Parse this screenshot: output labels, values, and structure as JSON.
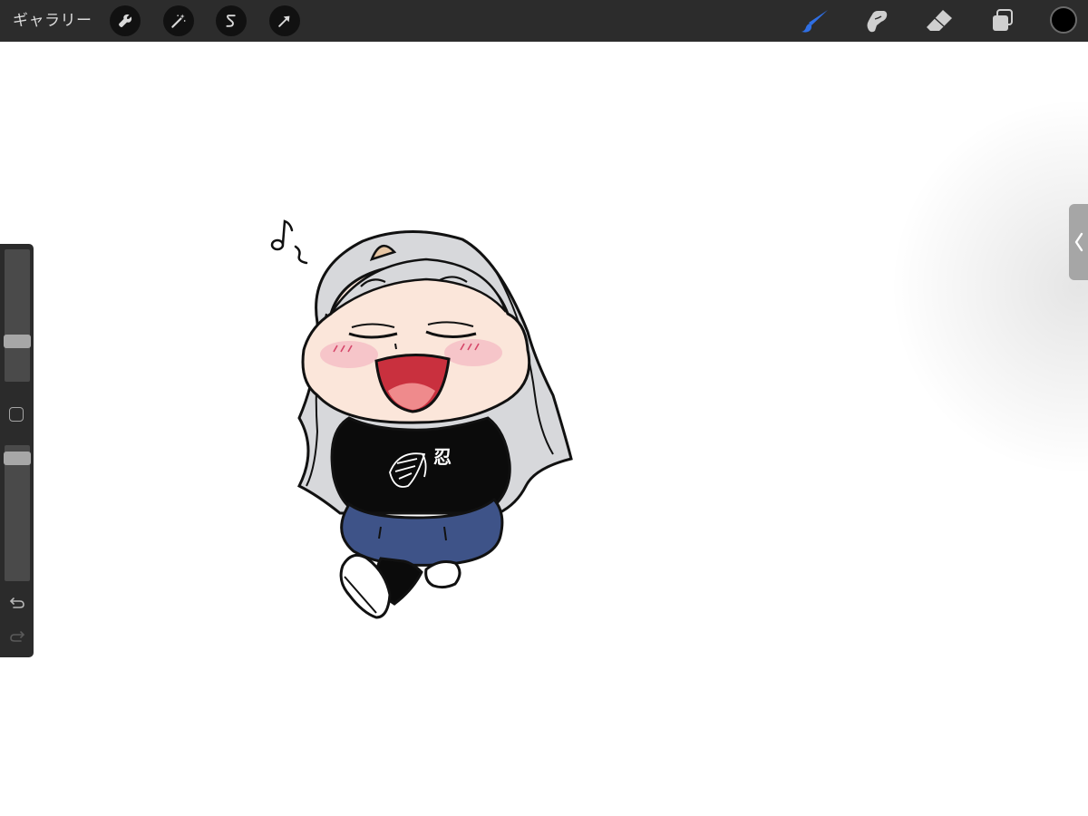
{
  "toolbar": {
    "gallery_label": "ギャラリー",
    "left_buttons": [
      {
        "name": "actions",
        "icon": "wrench-icon"
      },
      {
        "name": "adjustments",
        "icon": "magic-wand-icon"
      },
      {
        "name": "selection",
        "icon": "selection-s-icon"
      },
      {
        "name": "transform",
        "icon": "arrow-cursor-icon"
      }
    ],
    "right_tools": [
      {
        "name": "brush",
        "icon": "brush-icon",
        "active": true
      },
      {
        "name": "smudge",
        "icon": "smudge-icon",
        "active": false
      },
      {
        "name": "eraser",
        "icon": "eraser-icon",
        "active": false
      },
      {
        "name": "layers",
        "icon": "layers-icon",
        "active": false
      }
    ],
    "current_color": "#000000",
    "active_tool_color": "#2f6fe4"
  },
  "sidebar": {
    "brush_size_level": 0.28,
    "opacity_level": 0.95,
    "modify_icon": "square-icon",
    "undo_icon": "undo-icon",
    "redo_icon": "redo-icon",
    "redo_enabled": false
  },
  "canvas": {
    "background": "#ffffff",
    "artwork": {
      "music_note_icon": "music-note-icon",
      "shirt_kanji": "忍"
    }
  },
  "right_handle": {
    "icon": "chevron-left-icon"
  }
}
